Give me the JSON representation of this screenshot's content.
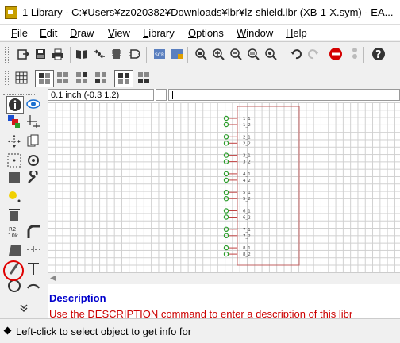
{
  "window": {
    "title": "1 Library - C:¥Users¥zz020382¥Downloads¥lbr¥lz-shield.lbr (XB-1-X.sym) - EA..."
  },
  "menu": [
    {
      "label": "File",
      "mnemonic": "F",
      "rest": "ile"
    },
    {
      "label": "Edit",
      "mnemonic": "E",
      "rest": "dit"
    },
    {
      "label": "Draw",
      "mnemonic": "D",
      "rest": "raw"
    },
    {
      "label": "View",
      "mnemonic": "V",
      "rest": "iew"
    },
    {
      "label": "Library",
      "mnemonic": "L",
      "rest": "ibrary"
    },
    {
      "label": "Options",
      "mnemonic": "O",
      "rest": "ptions"
    },
    {
      "label": "Window",
      "mnemonic": "W",
      "rest": "indow"
    },
    {
      "label": "Help",
      "mnemonic": "H",
      "rest": "elp"
    }
  ],
  "coord": {
    "value": "0.1 inch (-0.3 1.2)"
  },
  "pins": [
    {
      "top": "1_1",
      "bottom": "1_2"
    },
    {
      "top": "2_1",
      "bottom": "2_2"
    },
    {
      "top": "3_1",
      "bottom": "3_2"
    },
    {
      "top": "4_1",
      "bottom": "4_2"
    },
    {
      "top": "5_1",
      "bottom": "5_2"
    },
    {
      "top": "6_1",
      "bottom": "6_2"
    },
    {
      "top": "7_1",
      "bottom": "7_2"
    },
    {
      "top": "8_1",
      "bottom": "8_2"
    }
  ],
  "description": {
    "link": "Description",
    "text": "Use the DESCRIPTION command to enter a description of this libr"
  },
  "status": {
    "text": "Left-click to select object to get info for"
  },
  "colors": {
    "outline": "#c06060",
    "pin_green": "#2a9d2a",
    "selection_ring": "#e00000"
  }
}
